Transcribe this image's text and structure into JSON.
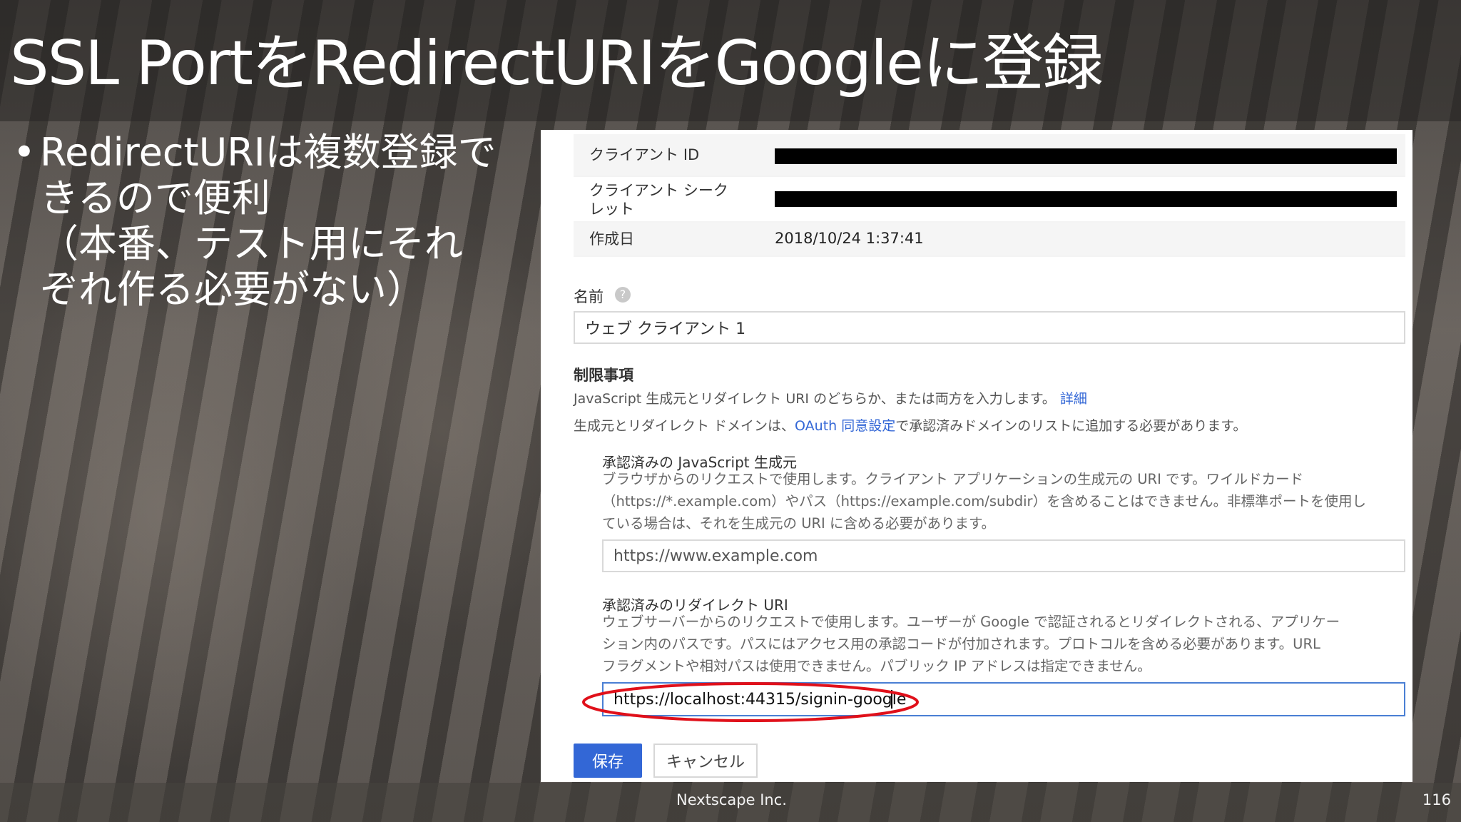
{
  "slide": {
    "title": "SSL PortをRedirectURIをGoogleに登録",
    "bullet_marker": "•",
    "bullet_lines": [
      "RedirectURIは複数登録で",
      "きるので便利",
      "（本番、テスト用にそれ",
      "ぞれ作る必要がない）"
    ],
    "footer_company": "Nextscape Inc.",
    "page_number": "116"
  },
  "console": {
    "client_id_label": "クライアント ID",
    "client_secret_label_line1": "クライアント シーク",
    "client_secret_label_line2": "レット",
    "created_label": "作成日",
    "created_value": "2018/10/24 1:37:41",
    "name_label": "名前",
    "help_icon_glyph": "?",
    "name_value": "ウェブ クライアント 1",
    "restrictions_title": "制限事項",
    "restrictions_desc1": "JavaScript 生成元とリダイレクト URI のどちらか、または両方を入力します。",
    "restrictions_desc1_link": "詳細",
    "restrictions_desc2_pre": "生成元とリダイレクト ドメインは、",
    "restrictions_desc2_link": "OAuth 同意設定",
    "restrictions_desc2_post": "で承認済みドメインのリストに追加する必要があります。",
    "js_origins_title": "承認済みの JavaScript 生成元",
    "js_origins_desc": [
      "ブラウザからのリクエストで使用します。クライアント アプリケーションの生成元の URI です。ワイルドカード",
      "（https://*.example.com）やパス（https://example.com/subdir）を含めることはできません。非標準ポートを使用し",
      "ている場合は、それを生成元の URI に含める必要があります。"
    ],
    "js_origins_placeholder": "https://www.example.com",
    "redirect_title": "承認済みのリダイレクト URI",
    "redirect_desc": [
      "ウェブサーバーからのリクエストで使用します。ユーザーが Google で認証されるとリダイレクトされる、アプリケー",
      "ション内のパスです。パスにはアクセス用の承認コードが付加されます。プロトコルを含める必要があります。URL",
      "フラグメントや相対パスは使用できません。パブリック IP アドレスは指定できません。"
    ],
    "redirect_value": "https://localhost:44315/signin-google",
    "save_label": "保存",
    "cancel_label": "キャンセル"
  },
  "colors": {
    "primary_blue": "#3367d6",
    "highlight_red": "#e0101a",
    "focused_border": "#4a7fd4"
  }
}
